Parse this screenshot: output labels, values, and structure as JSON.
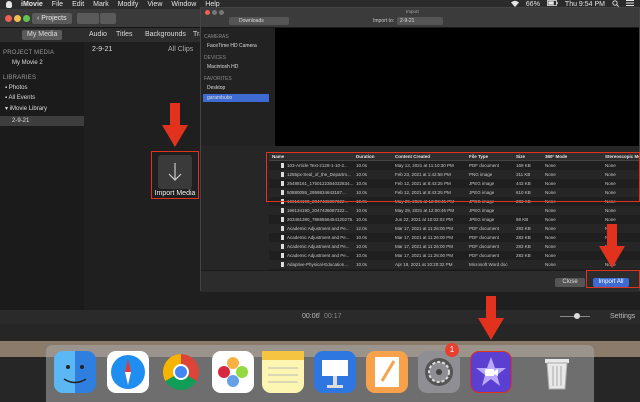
{
  "menubar": {
    "items": [
      "iMovie",
      "File",
      "Edit",
      "Mark",
      "Modify",
      "View",
      "Window",
      "Help"
    ],
    "battery": "66%",
    "time": "Thu 9:54 PM"
  },
  "toolbar": {
    "projects_label": "Projects"
  },
  "media_tabs": [
    "My Media",
    "Audio",
    "Titles",
    "Backgrounds",
    "Tra"
  ],
  "sidebar": {
    "section_project": "PROJECT MEDIA",
    "project_item": "My Movie 2",
    "section_libraries": "LIBRARIES",
    "library_items": [
      "Photos",
      "All Events",
      "iMovie Library",
      "2-9-21"
    ]
  },
  "browser": {
    "event_title": "2-9-21",
    "filter": "All Clips",
    "import_label": "Import Media"
  },
  "dialog": {
    "title": "Import",
    "location": "Downloads",
    "import_to_label": "Import to:",
    "import_to_value": "2-9-21",
    "sidebar": {
      "cameras_header": "CAMERAS",
      "camera": "FaceTime HD Camera",
      "devices_header": "DEVICES",
      "device": "Macintosh HD",
      "favorites_header": "FAVORITES",
      "favorites": [
        "Desktop",
        "garambubo"
      ]
    },
    "columns": [
      "Name",
      "Duration",
      "Content Created",
      "File Type",
      "Size",
      "360° Mode",
      "Stereoscopic Mod"
    ],
    "rows": [
      [
        "103-Article Text-2128-1-10-2...",
        "10.0s",
        "May 13, 2021 at 11:10:30 PM",
        "PDF document",
        "169 KB",
        "None",
        "None"
      ],
      [
        "1255px-Seal_of_the_Departm...",
        "10.0s",
        "Feb 23, 2021 at 1:42:58 PM",
        "PNG image",
        "311 KB",
        "None",
        "None"
      ],
      [
        "25488161_1750122354032834...",
        "10.0s",
        "Feb 12, 2021 at 8:43:25 PM",
        "JPEG image",
        "443 KB",
        "None",
        "None"
      ],
      [
        "50880055_2959834643187...",
        "10.0s",
        "Feb 12, 2021 at 8:43:25 PM",
        "JPEG image",
        "610 KB",
        "None",
        "None"
      ],
      [
        "166134190_2047436087322...",
        "10.0s",
        "May 29, 2021 at 12:00:45 PM",
        "JPEG image",
        "283 KB",
        "None",
        "None"
      ],
      [
        "166134190_2047436087322...",
        "10.0s",
        "May 29, 2021 at 12:00:45 PM",
        "JPEG image",
        "",
        "None",
        "None"
      ],
      [
        "203491380_7869556454120275...6413011344863596539_n.jpg",
        "10.0s",
        "Jun 22, 2021 at 10:02:02 PM",
        "JPEG image",
        "98 KB",
        "None",
        "None"
      ],
      [
        "Academic Adjustment and Pe...",
        "12.0s",
        "Mar 17, 2021 at 11:26:00 PM",
        "PDF document",
        "283 KB",
        "None",
        "None"
      ],
      [
        "Academic Adjustment and Pe...",
        "10.0s",
        "Mar 17, 2021 at 11:26:00 PM",
        "PDF document",
        "283 KB",
        "None",
        "None"
      ],
      [
        "Academic Adjustment and Pe...",
        "10.0s",
        "Mar 17, 2021 at 11:26:00 PM",
        "PDF document",
        "283 KB",
        "None",
        "None"
      ],
      [
        "Academic Adjustment and Pe...",
        "10.0s",
        "Mar 17, 2021 at 11:26:00 PM",
        "PDF document",
        "283 KB",
        "None",
        "None"
      ],
      [
        "Adaptive-Physical-Education...",
        "10.0s",
        "Apr 18, 2021 at 10:20:32 PM",
        "Microsoft Word doc",
        "",
        "None",
        "None"
      ],
      [
        "calvary (1).png",
        "10.0s",
        "Jul 17, 2021 at 10:07:58 PM",
        "PNG image",
        "",
        "None",
        "None"
      ]
    ],
    "close_label": "Close",
    "import_all_label": "Import All"
  },
  "timeline": {
    "current": "00:06",
    "total": "00:17",
    "settings_label": "Settings"
  },
  "dock": {
    "apps": [
      "finder-icon",
      "safari-icon",
      "chrome-icon",
      "photos-icon",
      "notes-icon",
      "keynote-icon",
      "pages-icon",
      "system-preferences-icon",
      "imovie-icon",
      "trash-icon"
    ],
    "badge_count": "1"
  },
  "colors": {
    "highlight": "#e0321c",
    "accent": "#3d6bd1"
  }
}
